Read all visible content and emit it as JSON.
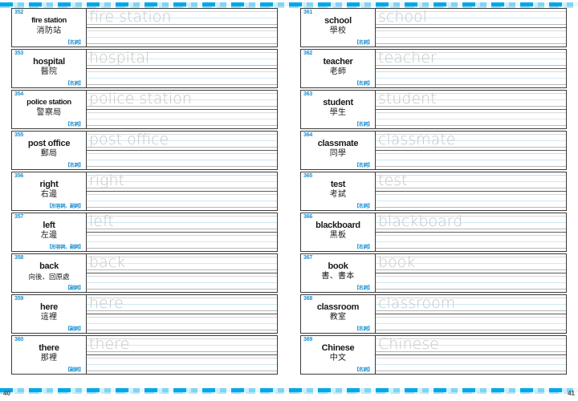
{
  "book": {
    "left_page_number": "40",
    "right_page_number": "41",
    "accent_color": "#00a8e8",
    "number_color": "#1b91d4",
    "tag_color": "#1b91d4",
    "trace_color": "#c6c6c6"
  },
  "left_page": {
    "entries": [
      {
        "number": "352",
        "english": "fire station",
        "chinese": "消防站",
        "pos": "【名詞】",
        "trace": "fire station"
      },
      {
        "number": "353",
        "english": "hospital",
        "chinese": "醫院",
        "pos": "【名詞】",
        "trace": "hospital"
      },
      {
        "number": "354",
        "english": "police station",
        "chinese": "警察局",
        "pos": "【名詞】",
        "trace": "police station"
      },
      {
        "number": "355",
        "english": "post office",
        "chinese": "郵局",
        "pos": "【名詞】",
        "trace": "post office"
      },
      {
        "number": "356",
        "english": "right",
        "chinese": "右邊",
        "pos": "【形容詞、副詞】",
        "trace": "right"
      },
      {
        "number": "357",
        "english": "left",
        "chinese": "左邊",
        "pos": "【形容詞、副詞】",
        "trace": "left"
      },
      {
        "number": "358",
        "english": "back",
        "chinese": "向後、回原處",
        "pos": "【副詞】",
        "trace": "back"
      },
      {
        "number": "359",
        "english": "here",
        "chinese": "這裡",
        "pos": "【副詞】",
        "trace": "here"
      },
      {
        "number": "360",
        "english": "there",
        "chinese": "那裡",
        "pos": "【副詞】",
        "trace": "there"
      }
    ]
  },
  "right_page": {
    "entries": [
      {
        "number": "361",
        "english": "school",
        "chinese": "學校",
        "pos": "【名詞】",
        "trace": "school"
      },
      {
        "number": "362",
        "english": "teacher",
        "chinese": "老師",
        "pos": "【名詞】",
        "trace": "teacher"
      },
      {
        "number": "363",
        "english": "student",
        "chinese": "學生",
        "pos": "【名詞】",
        "trace": "student"
      },
      {
        "number": "364",
        "english": "classmate",
        "chinese": "同學",
        "pos": "【名詞】",
        "trace": "classmate"
      },
      {
        "number": "365",
        "english": "test",
        "chinese": "考試",
        "pos": "【名詞】",
        "trace": "test"
      },
      {
        "number": "366",
        "english": "blackboard",
        "chinese": "黑板",
        "pos": "【名詞】",
        "trace": "blackboard"
      },
      {
        "number": "367",
        "english": "book",
        "chinese": "書、書本",
        "pos": "【名詞】",
        "trace": "book"
      },
      {
        "number": "368",
        "english": "classroom",
        "chinese": "教室",
        "pos": "【名詞】",
        "trace": "classroom"
      },
      {
        "number": "369",
        "english": "Chinese",
        "chinese": "中文",
        "pos": "【名詞】",
        "trace": "Chinese"
      }
    ]
  }
}
